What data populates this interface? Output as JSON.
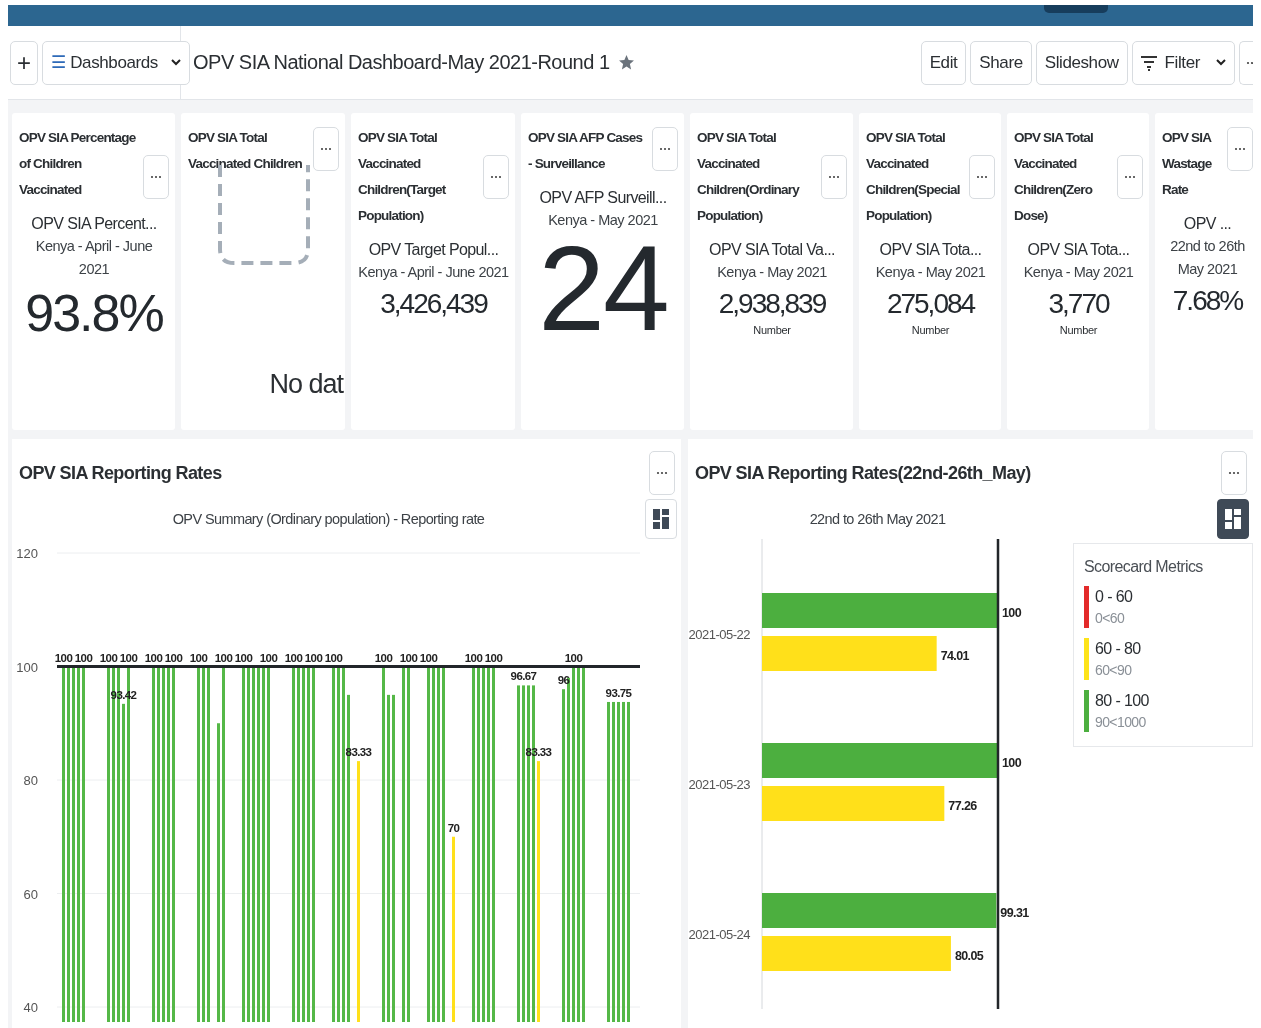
{
  "header": {
    "add_button": "+",
    "dashboards_button": {
      "icon": "☰",
      "label": "Dashboards"
    },
    "title": "OPV SIA National Dashboard-May 2021-Round 1",
    "actions": [
      "Edit",
      "Share",
      "Slideshow"
    ],
    "filter_button": "Filter"
  },
  "cards": [
    {
      "kind": "big",
      "title": "OPV SIA Percentage of Children Vaccinated",
      "subtitle": "OPV SIA Percent...",
      "period": "Kenya - April - June 2021",
      "value": "93.8%"
    },
    {
      "kind": "empty",
      "title": "OPV SIA Total Vaccinated Children",
      "message": "No dat"
    },
    {
      "kind": "medium",
      "title": "OPV SIA Total Vaccinated Children(Target Population)",
      "subtitle": "OPV Target Popul...",
      "period": "Kenya - April - June 2021",
      "value": "3,426,439"
    },
    {
      "kind": "huge",
      "title": "OPV SIA AFP Cases - Surveillance",
      "subtitle": "OPV AFP Surveill...",
      "period": "Kenya - May 2021",
      "value": "24"
    },
    {
      "kind": "medium",
      "title": "OPV SIA Total Vaccinated Children(Ordinary Population)",
      "subtitle": "OPV SIA Total Va...",
      "period": "Kenya - May 2021",
      "value": "2,938,839",
      "unit": "Number"
    },
    {
      "kind": "medium",
      "title": "OPV SIA Total Vaccinated Children(Special Population)",
      "subtitle": "OPV SIA Tota...",
      "period": "Kenya - May 2021",
      "value": "275,084",
      "unit": "Number"
    },
    {
      "kind": "medium",
      "title": "OPV SIA Total Vaccinated Children(Zero Dose)",
      "subtitle": "OPV SIA Tota...",
      "period": "Kenya - May 2021",
      "value": "3,770",
      "unit": "Number"
    },
    {
      "kind": "medium",
      "title": "OPV SIA Wastage Rate",
      "subtitle": "OPV ...",
      "period": "22nd to 26th May 2021",
      "value": "7.68%"
    }
  ],
  "left_panel": {
    "title": "OPV SIA Reporting Rates",
    "view_toggle": {
      "selected": false
    },
    "chart_data": {
      "type": "bar",
      "title": "OPV Summary (Ordinary population) - Reporting rate",
      "ylim": [
        40,
        120
      ],
      "yticks": [
        40,
        60,
        80,
        100,
        120
      ],
      "ref_lines": [
        {
          "axis": "y",
          "value": 100
        }
      ],
      "series": [
        {
          "color": "#55b847",
          "values": [
            null,
            100,
            100,
            100,
            100,
            100,
            null,
            null,
            null,
            null,
            100,
            100,
            100,
            93.42,
            100,
            null,
            null,
            null,
            null,
            100,
            100,
            100,
            100,
            100,
            null,
            null,
            null,
            null,
            100,
            100,
            100,
            null,
            90,
            100,
            null,
            null,
            null,
            100,
            100,
            100,
            100,
            100,
            100,
            null,
            null,
            null,
            null,
            100,
            100,
            100,
            100,
            100,
            null,
            null,
            null,
            100,
            100,
            100,
            95,
            null,
            null,
            null,
            null,
            null,
            null,
            100,
            95,
            95,
            null,
            100,
            100,
            null,
            null,
            null,
            100,
            100,
            100,
            100,
            null,
            null,
            null,
            null,
            null,
            100,
            100,
            100,
            100,
            100,
            null,
            null,
            null,
            null,
            96.67,
            96.67,
            96.67,
            96.67,
            null,
            null,
            null,
            null,
            null,
            96,
            98,
            100,
            100,
            100,
            null,
            null,
            null,
            null,
            93.75,
            93.75,
            93.75,
            93.75,
            93.75,
            null,
            null
          ]
        },
        {
          "color": "#ffe01a",
          "values": [
            null,
            null,
            null,
            null,
            null,
            null,
            null,
            null,
            null,
            null,
            null,
            null,
            null,
            null,
            null,
            null,
            null,
            null,
            null,
            null,
            null,
            null,
            null,
            null,
            null,
            null,
            null,
            null,
            null,
            null,
            null,
            null,
            null,
            null,
            null,
            null,
            null,
            null,
            null,
            null,
            null,
            null,
            null,
            null,
            null,
            null,
            null,
            null,
            null,
            null,
            null,
            null,
            null,
            null,
            null,
            null,
            null,
            null,
            null,
            null,
            83.33,
            null,
            null,
            null,
            null,
            null,
            null,
            null,
            null,
            null,
            null,
            null,
            null,
            null,
            null,
            null,
            null,
            null,
            null,
            70,
            null,
            null,
            null,
            null,
            null,
            null,
            null,
            null,
            null,
            null,
            null,
            null,
            null,
            null,
            null,
            null,
            83.33,
            null,
            null,
            null,
            null,
            null,
            null,
            null,
            null,
            null,
            null,
            null,
            null,
            null,
            null,
            null,
            null,
            null,
            null,
            null,
            null
          ]
        }
      ],
      "value_labels": [
        [
          null,
          "100",
          null,
          null,
          null,
          "100",
          null,
          null,
          null,
          null,
          "100",
          null,
          null,
          "93.42",
          "100",
          null,
          null,
          null,
          null,
          "100",
          null,
          null,
          null,
          "100",
          null,
          null,
          null,
          null,
          "100",
          null,
          null,
          null,
          null,
          "100",
          null,
          null,
          null,
          "100",
          null,
          null,
          null,
          null,
          "100",
          null,
          null,
          null,
          null,
          "100",
          null,
          null,
          null,
          "100",
          null,
          null,
          null,
          "100",
          null,
          null,
          null,
          null,
          null,
          null,
          null,
          null,
          null,
          "100",
          null,
          null,
          null,
          null,
          "100",
          null,
          null,
          null,
          "100",
          null,
          null,
          null,
          null,
          null,
          null,
          null,
          null,
          "100",
          null,
          null,
          null,
          "100",
          null,
          null,
          null,
          null,
          null,
          "96.67",
          null,
          null,
          null,
          null,
          null,
          null,
          null,
          "96",
          null,
          "100",
          null,
          null,
          null,
          null,
          null,
          null,
          null,
          null,
          "93.75",
          null,
          null,
          null,
          null,
          null
        ],
        [
          null,
          null,
          null,
          null,
          null,
          null,
          null,
          null,
          null,
          null,
          null,
          null,
          null,
          null,
          null,
          null,
          null,
          null,
          null,
          null,
          null,
          null,
          null,
          null,
          null,
          null,
          null,
          null,
          null,
          null,
          null,
          null,
          null,
          null,
          null,
          null,
          null,
          null,
          null,
          null,
          null,
          null,
          null,
          null,
          null,
          null,
          null,
          null,
          null,
          null,
          null,
          null,
          null,
          null,
          null,
          null,
          null,
          null,
          null,
          null,
          "83.33",
          null,
          null,
          null,
          null,
          null,
          null,
          null,
          null,
          null,
          null,
          null,
          null,
          null,
          null,
          null,
          null,
          null,
          null,
          "70",
          null,
          null,
          null,
          null,
          null,
          null,
          null,
          null,
          null,
          null,
          null,
          null,
          null,
          null,
          null,
          null,
          "83.33",
          null,
          null,
          null,
          null,
          null,
          null,
          null,
          null,
          null,
          null,
          null,
          null,
          null,
          null,
          null,
          null,
          null,
          null,
          null,
          null
        ]
      ]
    }
  },
  "right_panel": {
    "title": "OPV SIA Reporting Rates(22nd-26th_May)",
    "view_toggle": {
      "selected": true
    },
    "chart_data": {
      "type": "bar",
      "orientation": "horizontal",
      "title": "22nd to 26th May 2021",
      "categories": [
        "2021-05-22",
        "2021-05-23",
        "2021-05-24"
      ],
      "xlim": [
        0,
        100
      ],
      "data_labels": true,
      "series": [
        {
          "color": "#4caf3f",
          "values": [
            100,
            100,
            99.31
          ]
        },
        {
          "color": "#ffe01a",
          "values": [
            74.01,
            77.26,
            80.05
          ]
        }
      ]
    },
    "legend": {
      "title": "Scorecard Metrics",
      "items": [
        {
          "label": "0 - 60",
          "range": "0<60",
          "color": "#e32a2a"
        },
        {
          "label": "60 - 80",
          "range": "60<90",
          "color": "#fde31a"
        },
        {
          "label": "80 - 100",
          "range": "90<1000",
          "color": "#4caf3f"
        }
      ]
    }
  }
}
